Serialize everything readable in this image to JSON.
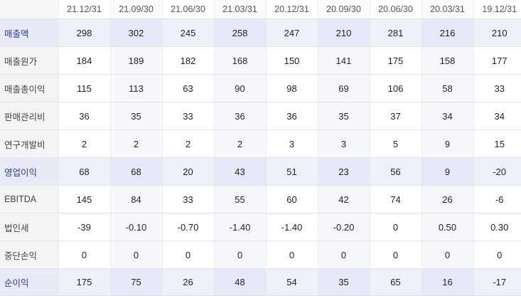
{
  "columns": [
    "21.12/31",
    "21.09/30",
    "21.06/30",
    "21.03/31",
    "20.12/31",
    "20.09/30",
    "20.06/30",
    "20.03/31",
    "19.12/31"
  ],
  "rows": [
    {
      "label": "매출액",
      "highlight": true,
      "values": [
        "298",
        "302",
        "245",
        "258",
        "247",
        "210",
        "281",
        "216",
        "210"
      ]
    },
    {
      "label": "매출원가",
      "highlight": false,
      "values": [
        "184",
        "189",
        "182",
        "168",
        "150",
        "141",
        "175",
        "158",
        "177"
      ]
    },
    {
      "label": "매출총이익",
      "highlight": false,
      "values": [
        "115",
        "113",
        "63",
        "90",
        "98",
        "69",
        "106",
        "58",
        "33"
      ]
    },
    {
      "label": "판매관리비",
      "highlight": false,
      "values": [
        "36",
        "35",
        "33",
        "36",
        "36",
        "35",
        "37",
        "34",
        "34"
      ]
    },
    {
      "label": "연구개발비",
      "highlight": false,
      "values": [
        "2",
        "2",
        "2",
        "2",
        "3",
        "3",
        "5",
        "9",
        "15"
      ]
    },
    {
      "label": "영업이익",
      "highlight": true,
      "values": [
        "68",
        "68",
        "20",
        "43",
        "51",
        "23",
        "56",
        "9",
        "-20"
      ]
    },
    {
      "label": "EBITDA",
      "highlight": false,
      "values": [
        "145",
        "84",
        "33",
        "55",
        "60",
        "42",
        "74",
        "26",
        "-6"
      ]
    },
    {
      "label": "법인세",
      "highlight": false,
      "values": [
        "-39",
        "-0.10",
        "-0.70",
        "-1.40",
        "-1.40",
        "-0.20",
        "0",
        "0.50",
        "0.30"
      ]
    },
    {
      "label": "중단손익",
      "highlight": false,
      "values": [
        "0",
        "0",
        "0",
        "0",
        "0",
        "0",
        "0",
        "0",
        "0"
      ]
    },
    {
      "label": "순이익",
      "highlight": true,
      "values": [
        "175",
        "75",
        "26",
        "48",
        "54",
        "35",
        "65",
        "16",
        "-17"
      ]
    }
  ]
}
